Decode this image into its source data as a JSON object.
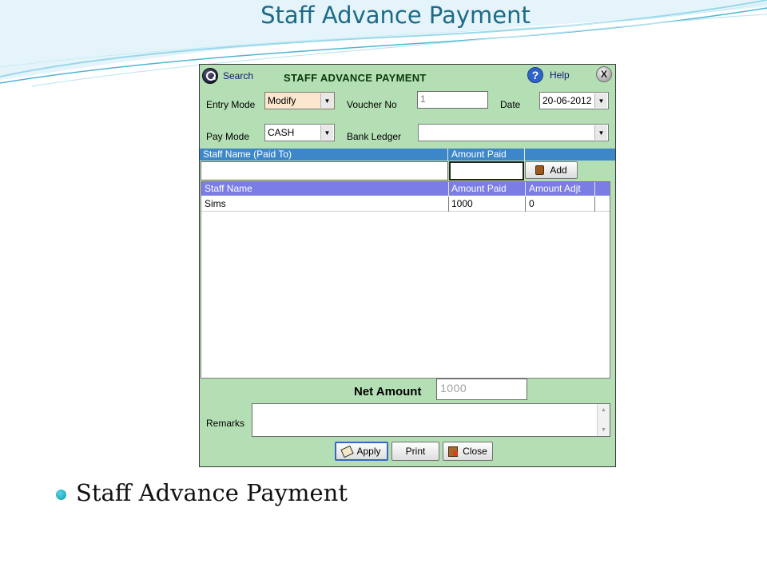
{
  "slide": {
    "title": "Staff Advance Payment",
    "bullet": "Staff Advance Payment",
    "accent_color": "#1e6a86",
    "bullet_color": "#28b5c9"
  },
  "window": {
    "search_label": "Search",
    "title": "STAFF ADVANCE PAYMENT",
    "help_label": "Help",
    "close_glyph": "X",
    "background_color": "#b4dfb4"
  },
  "form": {
    "entry_mode": {
      "label": "Entry Mode",
      "value": "Modify"
    },
    "voucher_no": {
      "label": "Voucher No",
      "value": "1"
    },
    "date": {
      "label": "Date",
      "value": "20-06-2012"
    },
    "pay_mode": {
      "label": "Pay Mode",
      "value": "CASH"
    },
    "bank_ledger": {
      "label": "Bank Ledger",
      "value": ""
    }
  },
  "entry_grid": {
    "columns": [
      "Staff Name  (Paid To)",
      "Amount Paid"
    ],
    "add_label": "Add",
    "header_color": "#3c87c8"
  },
  "list_grid": {
    "columns": [
      "Staff Name",
      "Amount Paid",
      "Amount Adjt"
    ],
    "rows": [
      {
        "staff_name": "Sims",
        "amount_paid": "1000",
        "amount_adjt": "0"
      }
    ],
    "header_color": "#7b7de4"
  },
  "net_amount": {
    "label": "Net Amount",
    "value": "1000"
  },
  "remarks": {
    "label": "Remarks",
    "value": ""
  },
  "buttons": {
    "apply": "Apply",
    "print": "Print",
    "close": "Close"
  }
}
